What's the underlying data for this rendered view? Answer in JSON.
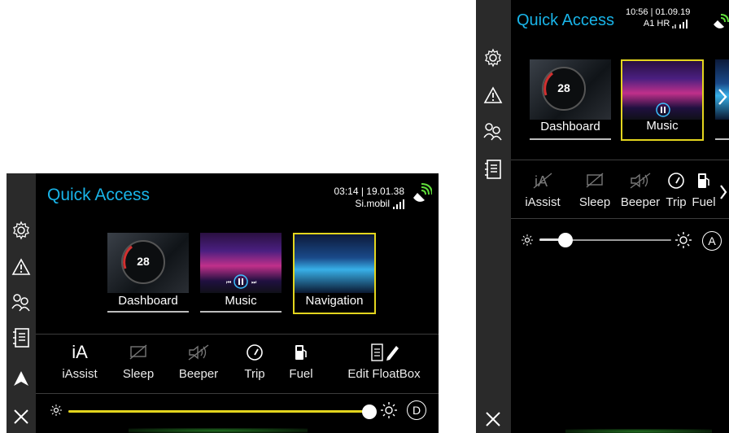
{
  "left": {
    "title": "Quick Access",
    "status_time": "03:14 | 19.01.38",
    "status_carrier": "Si.mobil",
    "tiles": [
      {
        "label": "Dashboard",
        "selected": false
      },
      {
        "label": "Music",
        "selected": false
      },
      {
        "label": "Navigation",
        "selected": true
      }
    ],
    "quick_items": [
      {
        "icon_text": "iA",
        "label": "iAssist"
      },
      {
        "label": "Sleep"
      },
      {
        "label": "Beeper"
      },
      {
        "label": "Trip"
      },
      {
        "label": "Fuel"
      },
      {
        "label": "Edit FloatBox"
      }
    ],
    "brightness_level": 1.0,
    "mode_badge": "D"
  },
  "right": {
    "title": "Quick Access",
    "status_time": "10:56 | 01.09.19",
    "status_carrier": "A1 HR",
    "tiles": [
      {
        "label": "Dashboard",
        "selected": false
      },
      {
        "label": "Music",
        "selected": true
      }
    ],
    "quick_items": [
      {
        "label": "iAssist"
      },
      {
        "label": "Sleep"
      },
      {
        "label": "Beeper"
      },
      {
        "label": "Trip"
      },
      {
        "label": "Fuel"
      }
    ],
    "brightness_level": 0.1,
    "mode_badge": "A"
  },
  "dashboard_speed": "28",
  "colors": {
    "accent": "#19b4e8",
    "selection": "#e3d51e",
    "sidebar": "#2a2a2a",
    "signal": "#5fdc3a"
  }
}
